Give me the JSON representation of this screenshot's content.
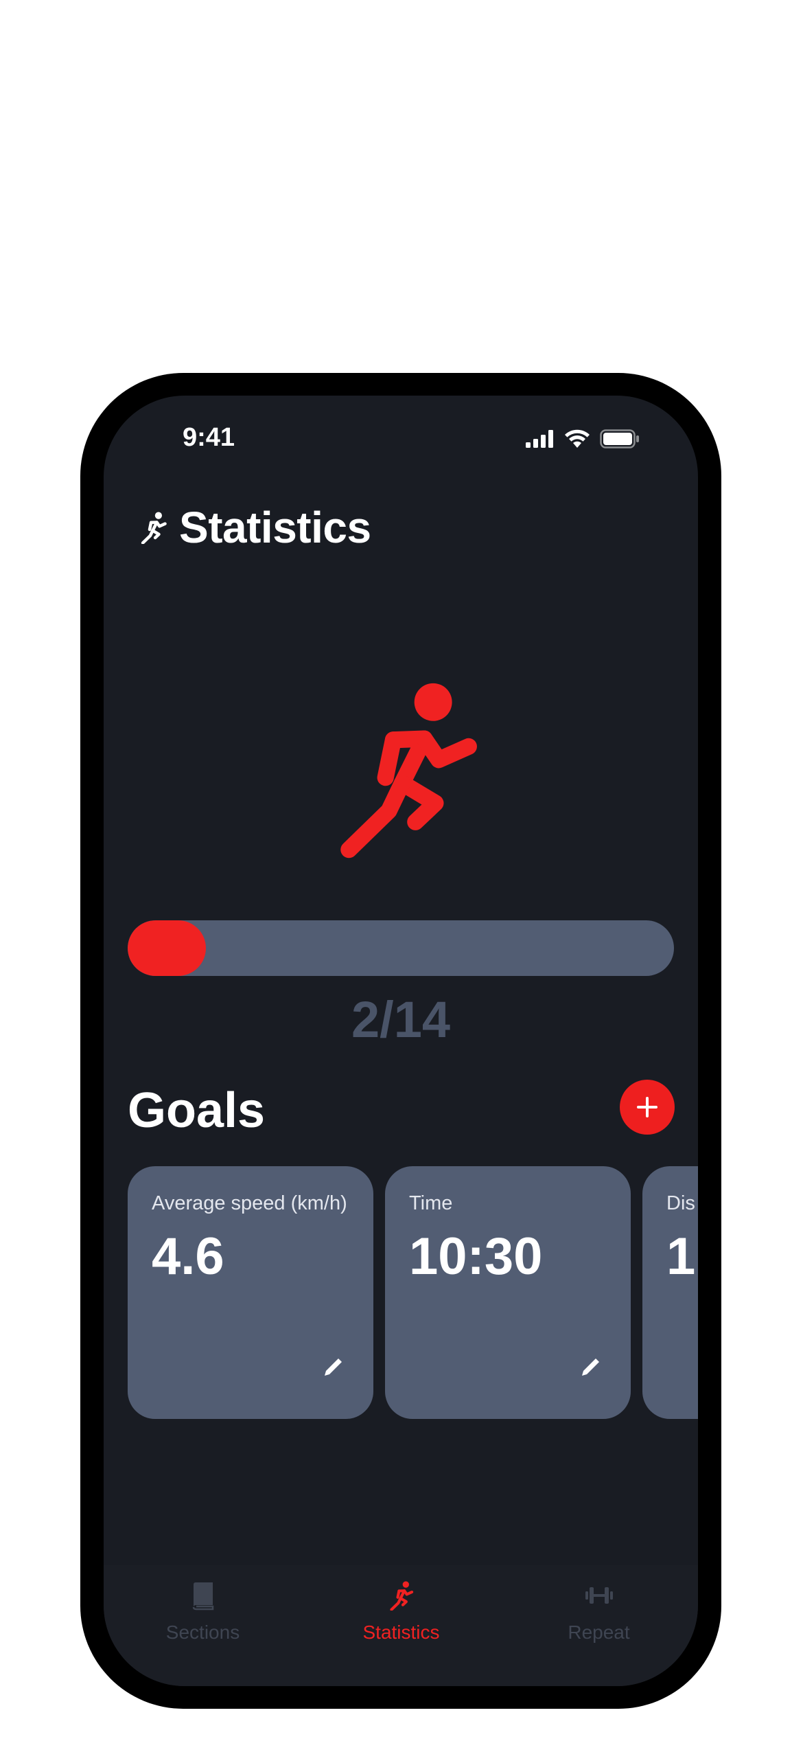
{
  "status_bar": {
    "time": "9:41"
  },
  "header": {
    "title": "Statistics",
    "icon": "running-icon"
  },
  "hero": {
    "icon": "running-icon",
    "color": "#f02222"
  },
  "progress": {
    "completed": 2,
    "total": 14,
    "label": "2/14",
    "fill_color": "#f02222",
    "track_color": "#525d73"
  },
  "goals": {
    "title": "Goals",
    "add_icon": "plus-icon",
    "cards": [
      {
        "label": "Average speed (km/h)",
        "value": "4.6",
        "edit_icon": "pencil-icon"
      },
      {
        "label": "Time",
        "value": "10:30",
        "edit_icon": "pencil-icon"
      },
      {
        "label": "Dis",
        "value": "1",
        "edit_icon": "pencil-icon"
      }
    ]
  },
  "tabs": [
    {
      "label": "Sections",
      "icon": "book-icon",
      "active": false
    },
    {
      "label": "Statistics",
      "icon": "running-icon",
      "active": true
    },
    {
      "label": "Repeat",
      "icon": "dumbbell-icon",
      "active": false
    }
  ],
  "colors": {
    "background": "#191c23",
    "accent": "#f02222",
    "card": "#525d73",
    "inactive_tab": "#3f4552"
  }
}
